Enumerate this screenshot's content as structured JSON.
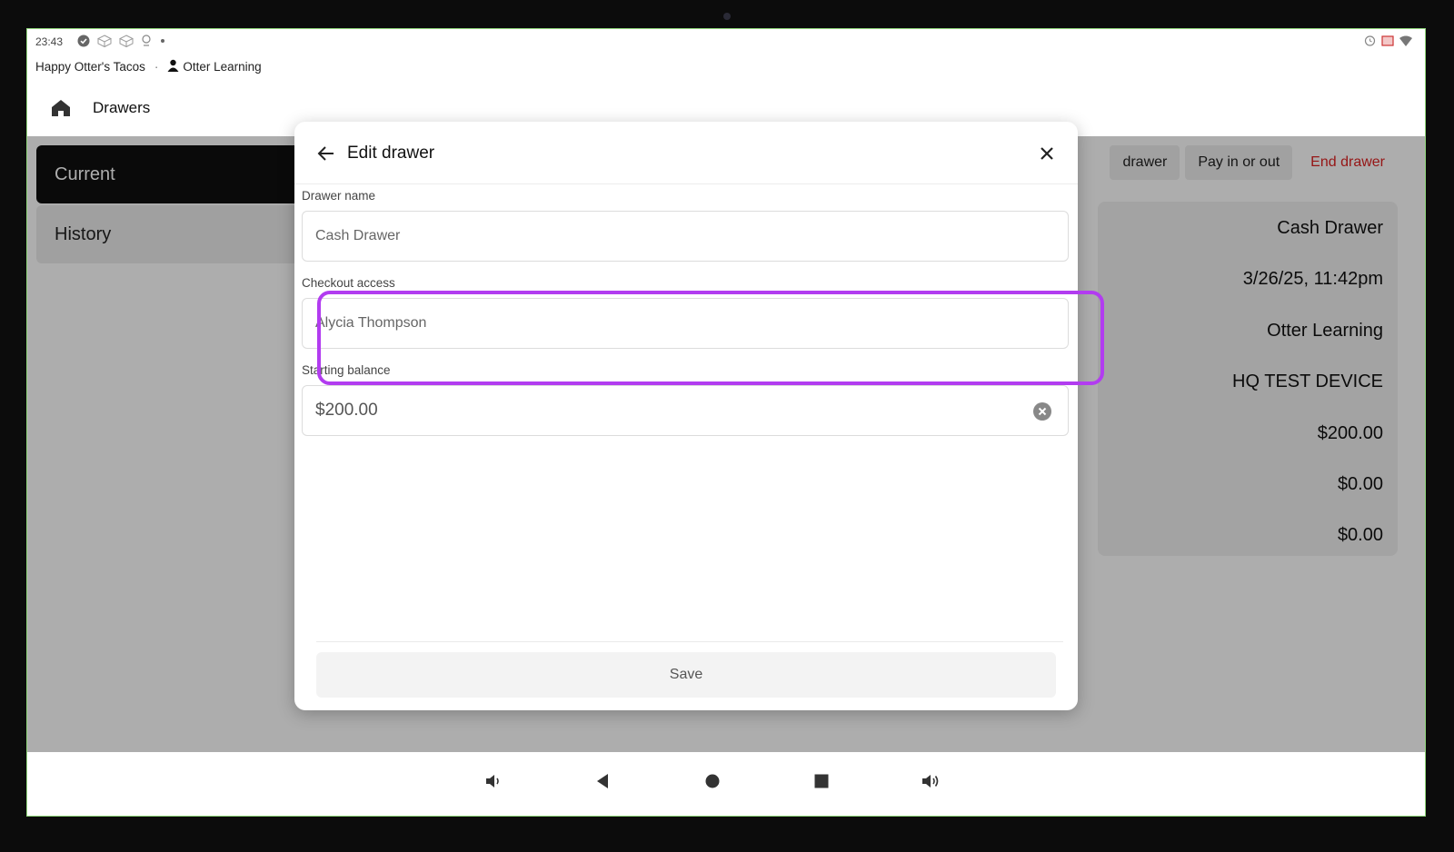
{
  "status_bar": {
    "time": "23:43"
  },
  "subheader": {
    "restaurant": "Happy Otter's Tacos",
    "separator": "·",
    "user": "Otter Learning"
  },
  "appbar": {
    "title": "Drawers"
  },
  "sidebar": {
    "items": [
      {
        "label": "Current"
      },
      {
        "label": "History"
      }
    ]
  },
  "actions": {
    "start_drawer_partial": "drawer",
    "pay": "Pay in or out",
    "end": "End drawer"
  },
  "details": [
    "Cash Drawer",
    "3/26/25, 11:42pm",
    "Otter Learning",
    "HQ TEST DEVICE",
    "$200.00",
    "$0.00",
    "$0.00"
  ],
  "modal": {
    "title": "Edit drawer",
    "drawer_name": {
      "label": "Drawer name",
      "value": "Cash Drawer"
    },
    "checkout_access": {
      "label": "Checkout access",
      "value": "Alycia Thompson"
    },
    "starting_balance": {
      "label": "Starting balance",
      "value": "$200.00"
    },
    "save_label": "Save"
  },
  "colors": {
    "highlight": "#b23cf0",
    "danger": "#d22222",
    "active_tab": "#0f0f0f"
  },
  "icons": {
    "back": "arrow-left-icon",
    "close": "close-icon",
    "clear": "clear-circle-icon",
    "home": "home-icon"
  }
}
